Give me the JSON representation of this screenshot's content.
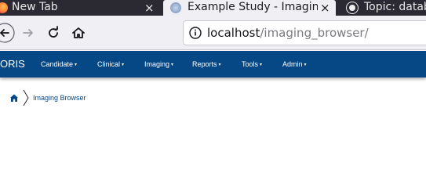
{
  "browser": {
    "tabs": [
      {
        "title": "New Tab",
        "active": false,
        "close": "×"
      },
      {
        "title": "Example Study - Imaging",
        "active": true,
        "close": "×"
      },
      {
        "title": "Topic: datab",
        "active": false
      }
    ],
    "url": {
      "host": "localhost",
      "path": "/imaging_browser/"
    }
  },
  "app": {
    "brand": "ORIS",
    "menu": [
      {
        "label": "Candidate"
      },
      {
        "label": "Clinical"
      },
      {
        "label": "Imaging"
      },
      {
        "label": "Reports"
      },
      {
        "label": "Tools"
      },
      {
        "label": "Admin"
      }
    ],
    "caret": "▾",
    "accent": "#064785"
  },
  "breadcrumb": {
    "current": "Imaging Browser"
  }
}
